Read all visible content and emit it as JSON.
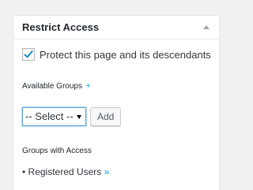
{
  "panel": {
    "title": "Restrict Access",
    "toggle_icon": "triangle-up-icon"
  },
  "protect": {
    "label": "Protect this page and its descendants",
    "checked": true
  },
  "available_groups": {
    "label": "Available Groups",
    "add_link": "+"
  },
  "group_select": {
    "selected": "-- Select --"
  },
  "add_button": {
    "label": "Add"
  },
  "groups_with_access": {
    "label": "Groups with Access",
    "items": [
      {
        "bullet": "•",
        "name": "Registered Users",
        "link": "»"
      }
    ]
  },
  "colors": {
    "accent": "#00a0d2",
    "check": "#1e8cbe",
    "focus_border": "#5b9dd9"
  }
}
